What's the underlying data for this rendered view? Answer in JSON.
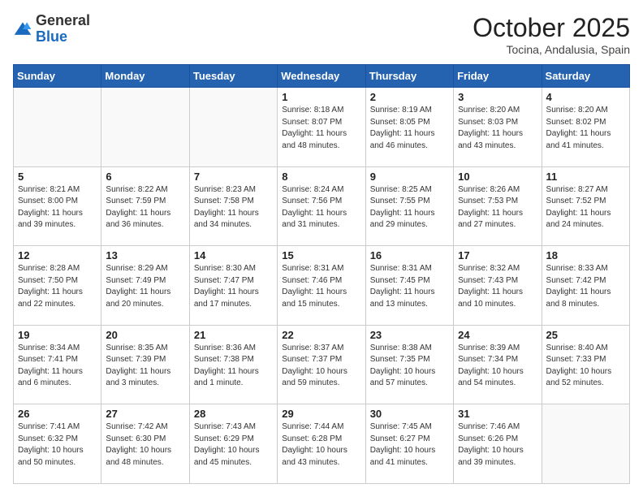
{
  "logo": {
    "general": "General",
    "blue": "Blue"
  },
  "header": {
    "month": "October 2025",
    "location": "Tocina, Andalusia, Spain"
  },
  "weekdays": [
    "Sunday",
    "Monday",
    "Tuesday",
    "Wednesday",
    "Thursday",
    "Friday",
    "Saturday"
  ],
  "weeks": [
    [
      {
        "day": "",
        "info": ""
      },
      {
        "day": "",
        "info": ""
      },
      {
        "day": "",
        "info": ""
      },
      {
        "day": "1",
        "info": "Sunrise: 8:18 AM\nSunset: 8:07 PM\nDaylight: 11 hours\nand 48 minutes."
      },
      {
        "day": "2",
        "info": "Sunrise: 8:19 AM\nSunset: 8:05 PM\nDaylight: 11 hours\nand 46 minutes."
      },
      {
        "day": "3",
        "info": "Sunrise: 8:20 AM\nSunset: 8:03 PM\nDaylight: 11 hours\nand 43 minutes."
      },
      {
        "day": "4",
        "info": "Sunrise: 8:20 AM\nSunset: 8:02 PM\nDaylight: 11 hours\nand 41 minutes."
      }
    ],
    [
      {
        "day": "5",
        "info": "Sunrise: 8:21 AM\nSunset: 8:00 PM\nDaylight: 11 hours\nand 39 minutes."
      },
      {
        "day": "6",
        "info": "Sunrise: 8:22 AM\nSunset: 7:59 PM\nDaylight: 11 hours\nand 36 minutes."
      },
      {
        "day": "7",
        "info": "Sunrise: 8:23 AM\nSunset: 7:58 PM\nDaylight: 11 hours\nand 34 minutes."
      },
      {
        "day": "8",
        "info": "Sunrise: 8:24 AM\nSunset: 7:56 PM\nDaylight: 11 hours\nand 31 minutes."
      },
      {
        "day": "9",
        "info": "Sunrise: 8:25 AM\nSunset: 7:55 PM\nDaylight: 11 hours\nand 29 minutes."
      },
      {
        "day": "10",
        "info": "Sunrise: 8:26 AM\nSunset: 7:53 PM\nDaylight: 11 hours\nand 27 minutes."
      },
      {
        "day": "11",
        "info": "Sunrise: 8:27 AM\nSunset: 7:52 PM\nDaylight: 11 hours\nand 24 minutes."
      }
    ],
    [
      {
        "day": "12",
        "info": "Sunrise: 8:28 AM\nSunset: 7:50 PM\nDaylight: 11 hours\nand 22 minutes."
      },
      {
        "day": "13",
        "info": "Sunrise: 8:29 AM\nSunset: 7:49 PM\nDaylight: 11 hours\nand 20 minutes."
      },
      {
        "day": "14",
        "info": "Sunrise: 8:30 AM\nSunset: 7:47 PM\nDaylight: 11 hours\nand 17 minutes."
      },
      {
        "day": "15",
        "info": "Sunrise: 8:31 AM\nSunset: 7:46 PM\nDaylight: 11 hours\nand 15 minutes."
      },
      {
        "day": "16",
        "info": "Sunrise: 8:31 AM\nSunset: 7:45 PM\nDaylight: 11 hours\nand 13 minutes."
      },
      {
        "day": "17",
        "info": "Sunrise: 8:32 AM\nSunset: 7:43 PM\nDaylight: 11 hours\nand 10 minutes."
      },
      {
        "day": "18",
        "info": "Sunrise: 8:33 AM\nSunset: 7:42 PM\nDaylight: 11 hours\nand 8 minutes."
      }
    ],
    [
      {
        "day": "19",
        "info": "Sunrise: 8:34 AM\nSunset: 7:41 PM\nDaylight: 11 hours\nand 6 minutes."
      },
      {
        "day": "20",
        "info": "Sunrise: 8:35 AM\nSunset: 7:39 PM\nDaylight: 11 hours\nand 3 minutes."
      },
      {
        "day": "21",
        "info": "Sunrise: 8:36 AM\nSunset: 7:38 PM\nDaylight: 11 hours\nand 1 minute."
      },
      {
        "day": "22",
        "info": "Sunrise: 8:37 AM\nSunset: 7:37 PM\nDaylight: 10 hours\nand 59 minutes."
      },
      {
        "day": "23",
        "info": "Sunrise: 8:38 AM\nSunset: 7:35 PM\nDaylight: 10 hours\nand 57 minutes."
      },
      {
        "day": "24",
        "info": "Sunrise: 8:39 AM\nSunset: 7:34 PM\nDaylight: 10 hours\nand 54 minutes."
      },
      {
        "day": "25",
        "info": "Sunrise: 8:40 AM\nSunset: 7:33 PM\nDaylight: 10 hours\nand 52 minutes."
      }
    ],
    [
      {
        "day": "26",
        "info": "Sunrise: 7:41 AM\nSunset: 6:32 PM\nDaylight: 10 hours\nand 50 minutes."
      },
      {
        "day": "27",
        "info": "Sunrise: 7:42 AM\nSunset: 6:30 PM\nDaylight: 10 hours\nand 48 minutes."
      },
      {
        "day": "28",
        "info": "Sunrise: 7:43 AM\nSunset: 6:29 PM\nDaylight: 10 hours\nand 45 minutes."
      },
      {
        "day": "29",
        "info": "Sunrise: 7:44 AM\nSunset: 6:28 PM\nDaylight: 10 hours\nand 43 minutes."
      },
      {
        "day": "30",
        "info": "Sunrise: 7:45 AM\nSunset: 6:27 PM\nDaylight: 10 hours\nand 41 minutes."
      },
      {
        "day": "31",
        "info": "Sunrise: 7:46 AM\nSunset: 6:26 PM\nDaylight: 10 hours\nand 39 minutes."
      },
      {
        "day": "",
        "info": ""
      }
    ]
  ]
}
